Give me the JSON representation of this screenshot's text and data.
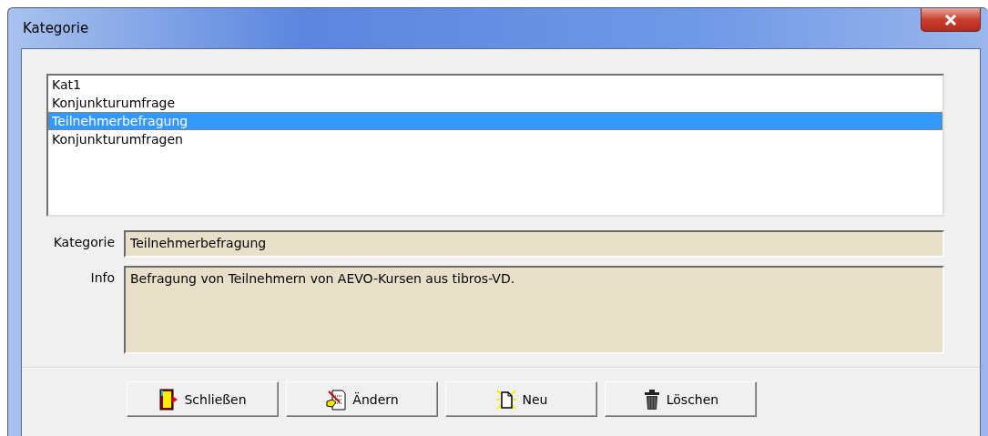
{
  "window": {
    "title": "Kategorie"
  },
  "list": {
    "items": [
      {
        "label": "Kat1",
        "selected": false
      },
      {
        "label": "Konjunkturumfrage",
        "selected": false
      },
      {
        "label": "Teilnehmerbefragung",
        "selected": true
      },
      {
        "label": "Konjunkturumfragen",
        "selected": false
      }
    ]
  },
  "fields": [
    {
      "label": "Kategorie",
      "value": "Teilnehmerbefragung",
      "kind": "line"
    },
    {
      "label": "Info",
      "value": "Befragung von Teilnehmern von AEVO-Kursen aus tibros-VD.",
      "kind": "area"
    }
  ],
  "buttons": [
    {
      "label": "Schließen",
      "kind": "close"
    },
    {
      "label": "Ändern",
      "kind": "edit"
    },
    {
      "label": "Neu",
      "kind": "new"
    },
    {
      "label": "Löschen",
      "kind": "delete"
    }
  ]
}
